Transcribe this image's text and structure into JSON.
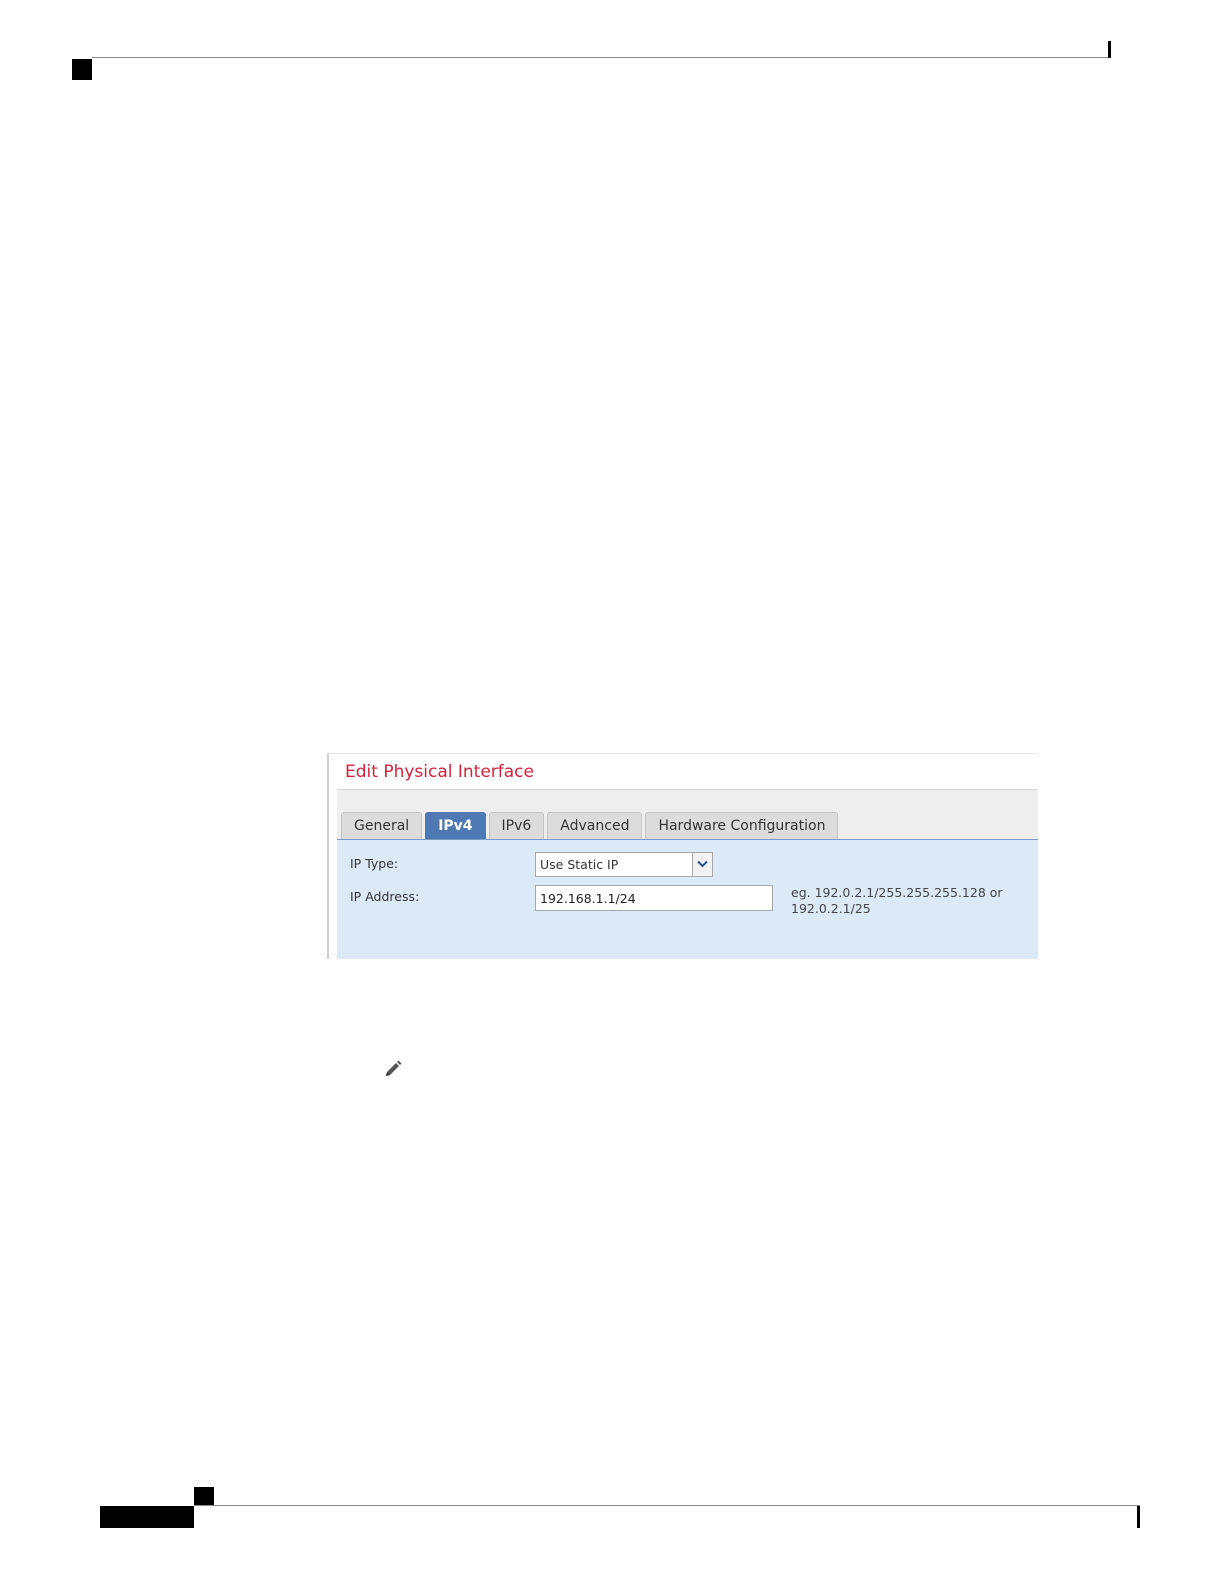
{
  "dialog": {
    "title": "Edit Physical Interface",
    "tabs": [
      {
        "label": "General",
        "active": false
      },
      {
        "label": "IPv4",
        "active": true
      },
      {
        "label": "IPv6",
        "active": false
      },
      {
        "label": "Advanced",
        "active": false
      },
      {
        "label": "Hardware Configuration",
        "active": false
      }
    ],
    "ip_type": {
      "label": "IP Type:",
      "value": "Use Static IP"
    },
    "ip_address": {
      "label": "IP Address:",
      "value": "192.168.1.1/24",
      "hint_line1": "eg. 192.0.2.1/255.255.255.128 or",
      "hint_line2": "192.0.2.1/25"
    }
  },
  "icons": {
    "note": "pencil-icon",
    "dropdown": "chevron-down-icon"
  },
  "colors": {
    "title": "#d2233e",
    "active_tab": "#4f79b3",
    "panel": "#dceaf8"
  }
}
